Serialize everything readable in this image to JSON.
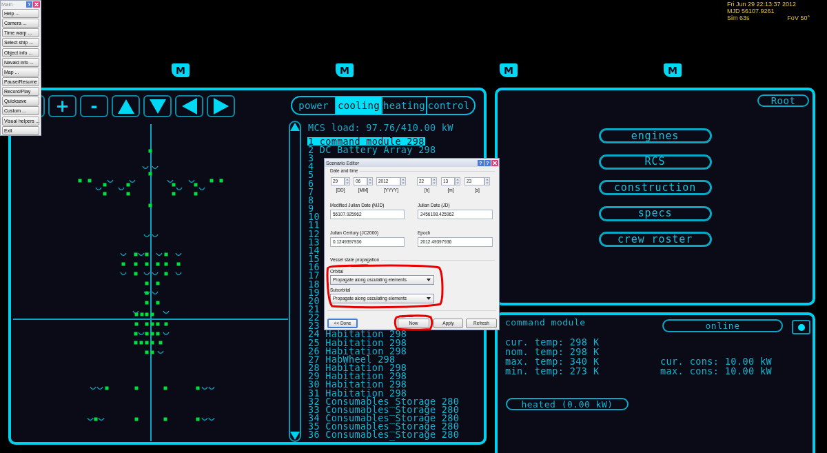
{
  "main_menu": {
    "title": "Main",
    "help": "?",
    "items": [
      "Help ...",
      "Camera ...",
      "Time warp ...",
      "Select ship ...",
      "Object info ...",
      "Navaid info ...",
      "Map ...",
      "Pause/Resume",
      "Record/Play",
      "Quicksave",
      "Custom ...",
      "Visual helpers ...",
      "Exit"
    ]
  },
  "hud": {
    "date_time": "Fri Jun 29 22:13:37 2012",
    "mjd": "MJD 56107.9261",
    "sim": "Sim 63s",
    "fov": "FoV 50°"
  },
  "mfd_buttons": [
    "M",
    "M",
    "M",
    "M"
  ],
  "left_mfd": {
    "toolbar": [
      {
        "kind": "blank"
      },
      {
        "kind": "text",
        "label": "+"
      },
      {
        "kind": "text",
        "label": "-"
      },
      {
        "kind": "up"
      },
      {
        "kind": "down"
      },
      {
        "kind": "left"
      },
      {
        "kind": "right"
      }
    ],
    "tabs": [
      {
        "label": "power",
        "selected": false
      },
      {
        "label": "cooling",
        "selected": true
      },
      {
        "label": "heating",
        "selected": false
      },
      {
        "label": "control",
        "selected": false
      }
    ],
    "list": {
      "header": "MCS load: 97.76/410.00 kW",
      "items": [
        {
          "text": "1 command module 298",
          "selected": true
        },
        {
          "text": "2 DC Battery Array 298",
          "selected": false
        },
        {
          "text": "3",
          "selected": false
        },
        {
          "text": "4",
          "selected": false
        },
        {
          "text": "5",
          "selected": false
        },
        {
          "text": "6",
          "selected": false
        },
        {
          "text": "7",
          "selected": false
        },
        {
          "text": "8",
          "selected": false
        },
        {
          "text": "9",
          "selected": false
        },
        {
          "text": "10",
          "selected": false
        },
        {
          "text": "11",
          "selected": false
        },
        {
          "text": "12",
          "selected": false
        },
        {
          "text": "13",
          "selected": false
        },
        {
          "text": "14",
          "selected": false
        },
        {
          "text": "15",
          "selected": false
        },
        {
          "text": "16",
          "selected": false
        },
        {
          "text": "17",
          "selected": false
        },
        {
          "text": "18",
          "selected": false
        },
        {
          "text": "19",
          "selected": false
        },
        {
          "text": "20",
          "selected": false
        },
        {
          "text": "21",
          "selected": false
        },
        {
          "text": "22",
          "selected": false
        },
        {
          "text": "23",
          "selected": false
        },
        {
          "text": "24 Habitation 298",
          "selected": false
        },
        {
          "text": "25 Habitation 298",
          "selected": false
        },
        {
          "text": "26 Habitation 298",
          "selected": false
        },
        {
          "text": "27 HabWheel 298",
          "selected": false
        },
        {
          "text": "28 Habitation 298",
          "selected": false
        },
        {
          "text": "29 Habitation 298",
          "selected": false
        },
        {
          "text": "30 Habitation 298",
          "selected": false
        },
        {
          "text": "31 Habitation 298",
          "selected": false
        },
        {
          "text": "32 Consumables_Storage 280",
          "selected": false
        },
        {
          "text": "33 Consumables_Storage 280",
          "selected": false
        },
        {
          "text": "34 Consumables_Storage 280",
          "selected": false
        },
        {
          "text": "35 Consumables_Storage 280",
          "selected": false
        },
        {
          "text": "36 Consumables_Storage 280",
          "selected": false
        }
      ]
    }
  },
  "right_mfd": {
    "root": "Root",
    "menu": [
      "engines",
      "RCS",
      "construction",
      "specs",
      "crew roster"
    ]
  },
  "module_panel": {
    "title": "command module",
    "status": "online",
    "indicator": {
      "on": true
    },
    "stats_left": [
      "cur. temp: 298 K",
      "nom. temp: 298 K",
      "max. temp: 340 K",
      "min. temp: 273 K"
    ],
    "stats_right": [
      "cur. cons: 10.00 kW",
      "max. cons: 10.00 kW"
    ],
    "mode": "heated (0.00 kW)"
  },
  "scenario_editor": {
    "title": "Scenario Editor",
    "help_buttons": [
      "?",
      "?"
    ],
    "date_time": {
      "label": "Date and time",
      "fields": [
        {
          "value": "29",
          "unit": "[DD]"
        },
        {
          "value": "06",
          "unit": "[MM]"
        },
        {
          "value": "2012",
          "unit": "[YYYY]"
        },
        {
          "value": "22",
          "unit": "[h]"
        },
        {
          "value": "13",
          "unit": "[m]"
        },
        {
          "value": "23",
          "unit": "[s]"
        }
      ]
    },
    "dates": [
      {
        "label": "Modified Julian Date (MJD)",
        "value": "56107.925962"
      },
      {
        "label": "Julian Date (JD)",
        "value": "2456108.425962"
      },
      {
        "label": "Julian Century (JC2000)",
        "value": "0.1249397936"
      },
      {
        "label": "Epoch",
        "value": "2012.49397936"
      }
    ],
    "propagation": {
      "label": "Vessel state propagation",
      "selectors": [
        {
          "label": "Orbital",
          "value": "Propagate along osculating elements"
        },
        {
          "label": "Suborbital",
          "value": "Propagate along osculating elements"
        }
      ]
    },
    "buttons": [
      {
        "label": "<< Done",
        "focused": true
      },
      {
        "label": "Now",
        "focused": false
      },
      {
        "label": "Apply",
        "focused": false
      },
      {
        "label": "Refresh",
        "focused": false
      }
    ]
  }
}
